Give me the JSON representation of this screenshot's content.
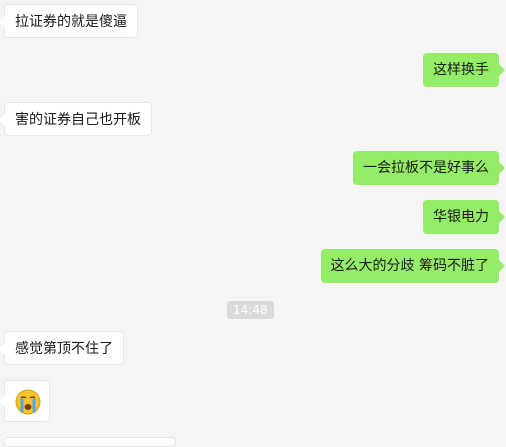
{
  "messages": [
    {
      "side": "left",
      "text": "拉证券的就是傻逼"
    },
    {
      "side": "right",
      "text": "这样换手"
    },
    {
      "side": "left",
      "text": "害的证券自己也开板"
    },
    {
      "side": "right",
      "text": "一会拉板不是好事么"
    },
    {
      "side": "right",
      "text": "华银电力"
    },
    {
      "side": "right",
      "text": "这么大的分歧  筹码不脏了"
    },
    {
      "side": "left",
      "text": "感觉第顶不住了"
    }
  ],
  "timestamp": "14:48",
  "emoji_message": {
    "icon": "crying-face-icon"
  },
  "colors": {
    "background": "#f5f5f5",
    "incoming_bubble": "#ffffff",
    "outgoing_bubble": "#95ec69",
    "timestamp_bg": "#dadada"
  }
}
